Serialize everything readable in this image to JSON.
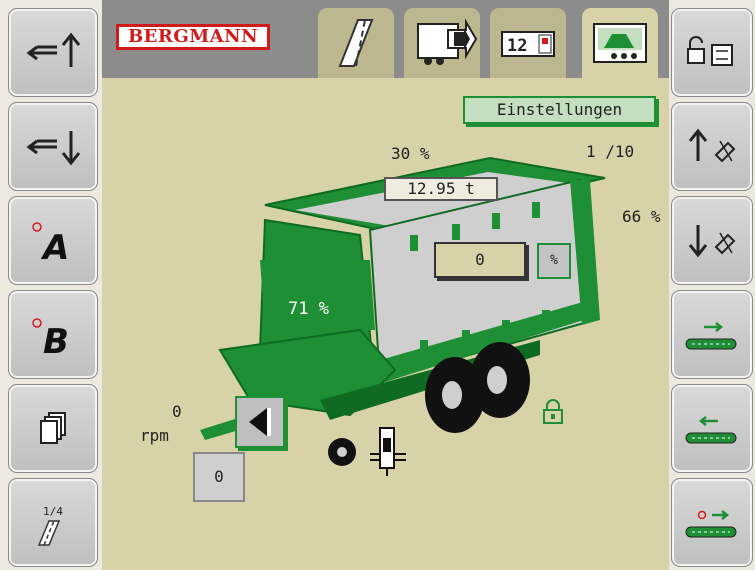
{
  "brand": {
    "name": "BERGMANN"
  },
  "tabs": [
    {
      "name": "road-tab-icon",
      "active": false
    },
    {
      "name": "unload-tab-icon",
      "active": false
    },
    {
      "name": "counter-tab-icon",
      "active": false
    },
    {
      "name": "overview-tab-icon",
      "active": true
    }
  ],
  "left_buttons": [
    {
      "name": "drawbar-up-icon"
    },
    {
      "name": "drawbar-down-icon"
    },
    {
      "name": "mode-a-icon",
      "label": "A"
    },
    {
      "name": "mode-b-icon",
      "label": "B"
    },
    {
      "name": "pages-icon"
    },
    {
      "name": "road-page-icon",
      "label": "1/4"
    }
  ],
  "right_buttons": [
    {
      "name": "lock-unlock-icon"
    },
    {
      "name": "pickup-up-icon"
    },
    {
      "name": "pickup-down-icon"
    },
    {
      "name": "conveyor-forward-icon"
    },
    {
      "name": "conveyor-reverse-icon"
    },
    {
      "name": "conveyor-auto-icon"
    }
  ],
  "main": {
    "settings_label": "Einstellungen",
    "fill_top": "30 %",
    "count": "1 /10",
    "fill_right": "66 %",
    "weight": "12.95 t",
    "center_value": "0",
    "percent_button": "%",
    "front_fill": "71 %",
    "rpm_value": "0",
    "rpm_unit": "rpm",
    "bottom_value": "0"
  },
  "colors": {
    "green": "#1e8f34",
    "dark_green": "#0f6b22",
    "brand_red": "#d11a1a",
    "panel": "#d8d2a8"
  }
}
